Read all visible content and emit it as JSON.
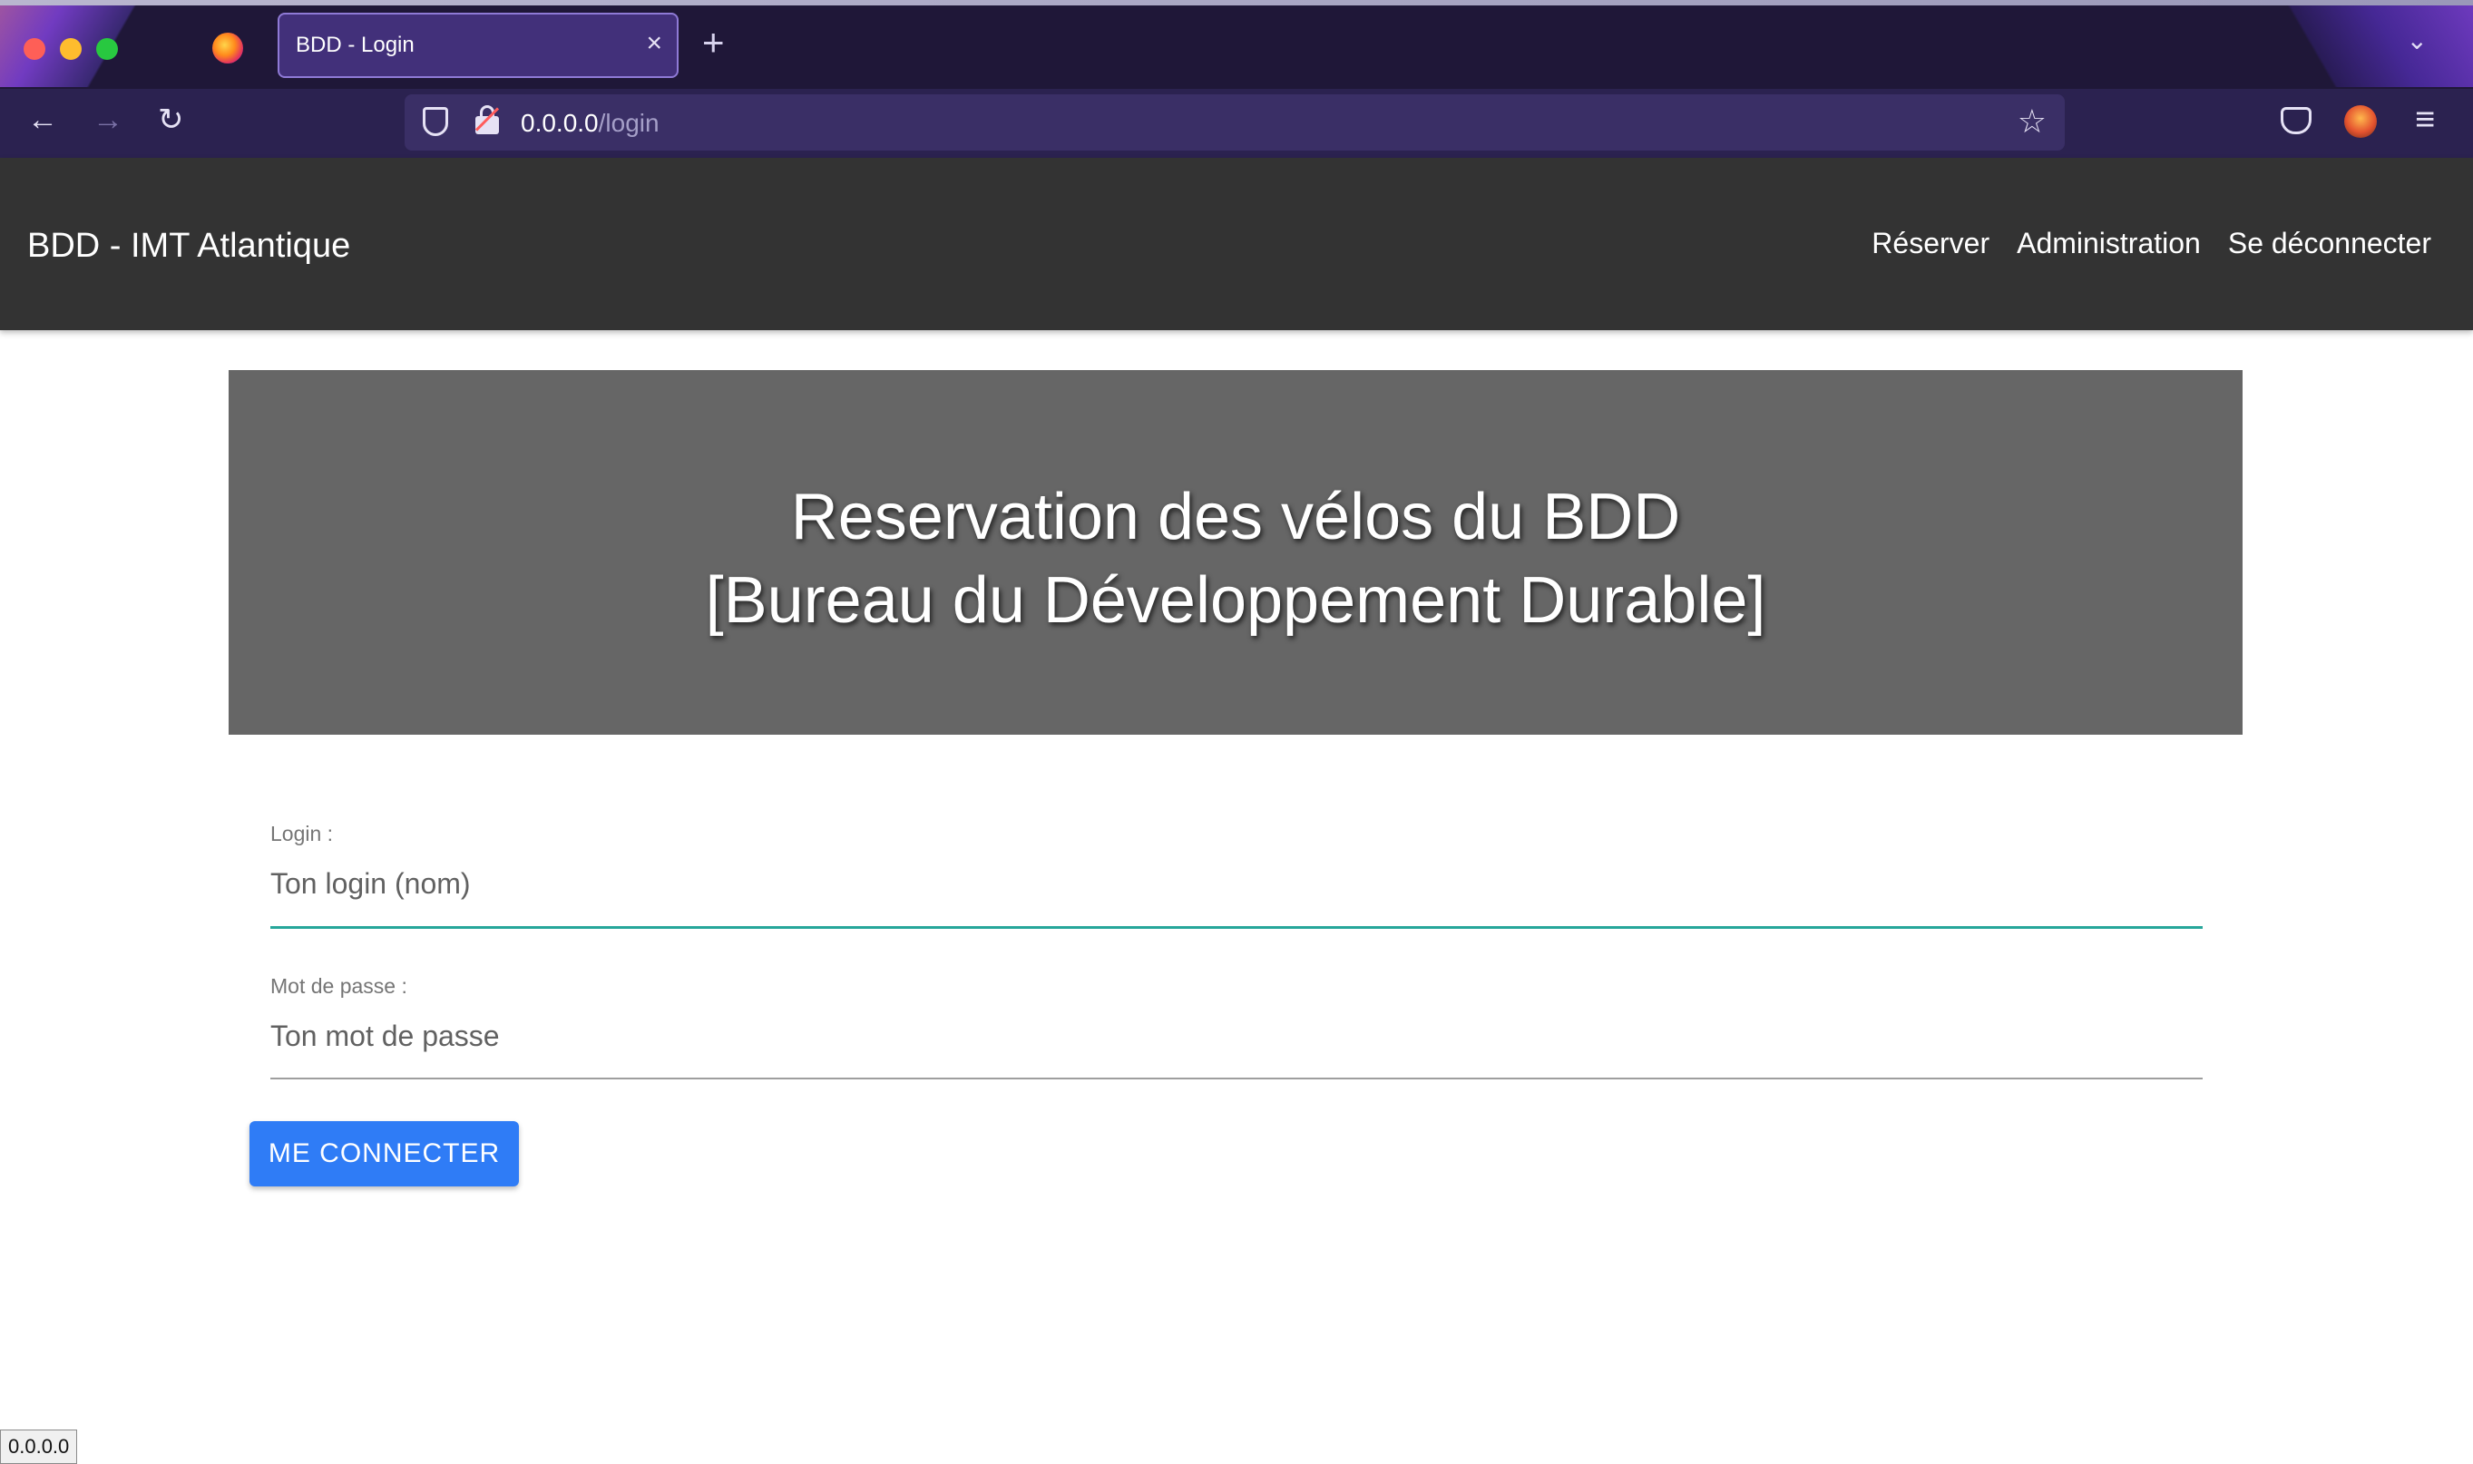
{
  "browser": {
    "tab_title": "BDD - Login",
    "tab_close": "×",
    "new_tab": "+",
    "tab_list": "⌄",
    "url_host": "0.0.0.0",
    "url_path": "/login",
    "back": "←",
    "forward": "→",
    "reload": "↻",
    "star": "☆",
    "menu": "≡",
    "status_url": "0.0.0.0"
  },
  "navbar": {
    "brand": "BDD - IMT Atlantique",
    "links": [
      "Réserver",
      "Administration",
      "Se déconnecter"
    ]
  },
  "hero": {
    "line1": "Reservation des vélos du BDD",
    "line2": "[Bureau du Développement Durable]"
  },
  "form": {
    "login_label": "Login :",
    "login_placeholder": "Ton login (nom)",
    "login_value": "",
    "password_label": "Mot de passe :",
    "password_placeholder": "Ton mot de passe",
    "password_value": "",
    "submit_label": "ME CONNECTER"
  },
  "colors": {
    "chrome_bg": "#1f1738",
    "navbar_bg": "#333333",
    "hero_bg": "#666666",
    "accent_underline": "#26a69a",
    "button": "#2f7cf6"
  },
  "icons": {
    "tab_icon": "firefox-icon",
    "url_security": "shield-icon",
    "url_lock": "insecure-lock-icon",
    "pocket": "pocket-icon",
    "account": "account-icon"
  }
}
